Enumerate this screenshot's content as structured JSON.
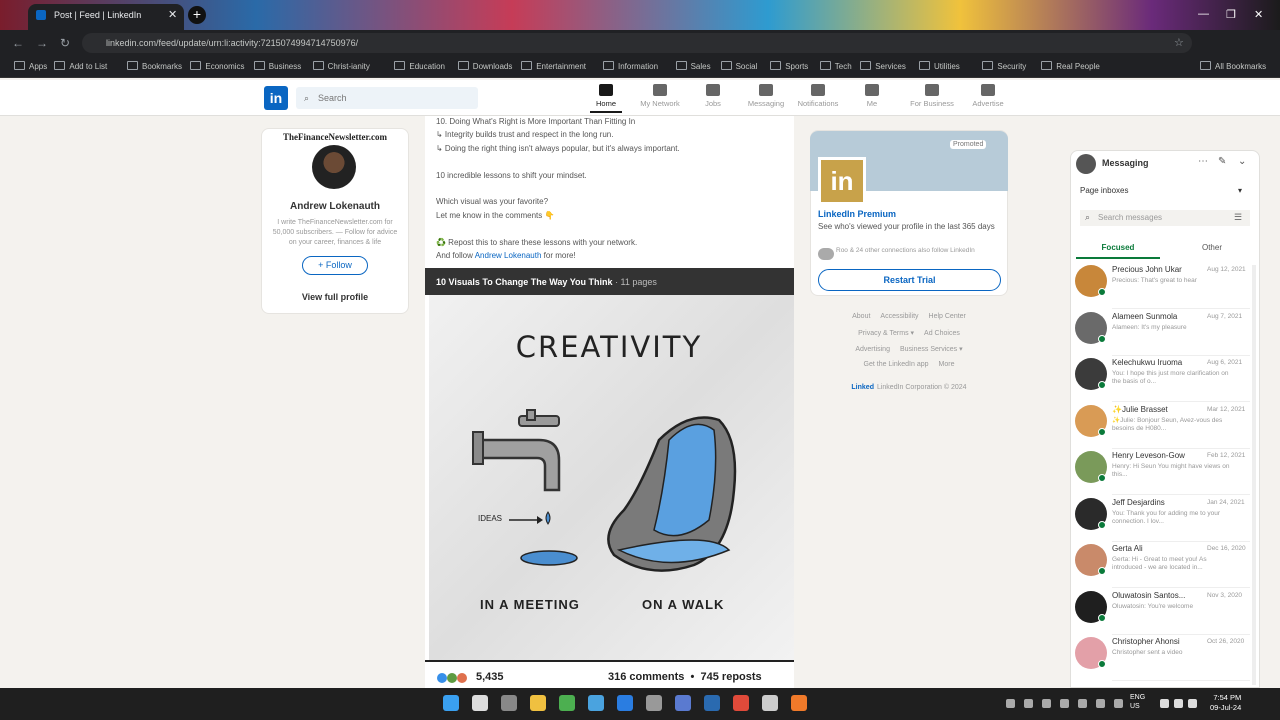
{
  "browser": {
    "tab_title": "Post | Feed | LinkedIn",
    "url": "linkedin.com/feed/update/urn:li:activity:7215074994714750976/",
    "bookmarks": [
      "Apps",
      "Add to List",
      "Bookmarks",
      "Economics",
      "Business",
      "Christ-ianity",
      "Education",
      "Downloads",
      "Entertainment",
      "Information",
      "Sales",
      "Social",
      "Sports",
      "Tech",
      "Services",
      "Utilities",
      "Security",
      "Real People"
    ],
    "all_bookmarks": "All Bookmarks"
  },
  "header": {
    "search_placeholder": "Search",
    "nav": [
      "Home",
      "My Network",
      "Jobs",
      "Messaging",
      "Notifications",
      "Me",
      "For Business",
      "Advertise"
    ]
  },
  "profile": {
    "newsletter": "TheFinanceNewsletter.com",
    "name": "Andrew Lokenauth",
    "desc": "I write TheFinanceNewsletter.com for 50,000 subscribers. — Follow for advice on your career, finances & life",
    "follow_label": "+ Follow",
    "view_profile": "View full profile"
  },
  "post": {
    "lines": [
      "10. Doing What's Right is More Important Than Fitting In",
      "↳ Integrity builds trust and respect in the long run.",
      "↳ Doing the right thing isn't always popular, but it's always important.",
      "10 incredible lessons to shift your mindset.",
      "Which visual was your favorite?",
      "Let me know in the comments 👇",
      "♻️ Repost this to share these lessons with your network.",
      "And follow"
    ],
    "author_link": "Andrew Lokenauth",
    "follow_suffix": "for more!",
    "doc_title": "10 Visuals To Change The Way You Think",
    "doc_pages": "· 11 pages",
    "slide_heading": "CREATIVITY",
    "ideas_label": "IDEAS",
    "caption_left": "IN A MEETING",
    "caption_right": "ON A WALK",
    "reactions": "5,435",
    "comments": "316 comments",
    "reposts": "745 reposts"
  },
  "promo": {
    "promoted": "Promoted",
    "title": "LinkedIn Premium",
    "body": "See who's viewed your profile in the last 365 days",
    "connections": "Roo & 24 other connections also follow LinkedIn",
    "cta": "Restart Trial"
  },
  "footer": {
    "links1": [
      "About",
      "Accessibility",
      "Help Center"
    ],
    "links2": [
      "Privacy & Terms ▾",
      "Ad Choices"
    ],
    "links3": [
      "Advertising",
      "Business Services ▾"
    ],
    "links4": [
      "Get the LinkedIn app",
      "More"
    ],
    "copyright": "LinkedIn Corporation © 2024"
  },
  "messaging": {
    "title": "Messaging",
    "inbox": "Page inboxes",
    "search_placeholder": "Search messages",
    "tab_focused": "Focused",
    "tab_other": "Other",
    "conversations": [
      {
        "name": "Precious John Ukar",
        "date": "Aug 12, 2021",
        "preview": "Precious: That's great to hear",
        "color": "#c8873a"
      },
      {
        "name": "Alameen Sunmola",
        "date": "Aug 7, 2021",
        "preview": "Alameen: It's my pleasure",
        "color": "#6a6a6a"
      },
      {
        "name": "Kelechukwu Iruoma",
        "date": "Aug 6, 2021",
        "preview": "You: I hope this just more clarification on the basis of o...",
        "color": "#3b3b3b"
      },
      {
        "name": "✨Julie Brasset",
        "date": "Mar 12, 2021",
        "preview": "✨Julie: Bonjour Seun, Avez-vous des besoins de H080...",
        "color": "#d99b55"
      },
      {
        "name": "Henry Leveson-Gow",
        "date": "Feb 12, 2021",
        "preview": "Henry: Hi Seun You might have views on this...",
        "color": "#7a9a5a"
      },
      {
        "name": "Jeff Desjardins",
        "date": "Jan 24, 2021",
        "preview": "You: Thank you for adding me to your connection. I lov...",
        "color": "#2a2a2a"
      },
      {
        "name": "Gerta Ali",
        "date": "Dec 16, 2020",
        "preview": "Gerta: Hi - Great to meet you! As introduced - we are located in...",
        "color": "#c98a6a"
      },
      {
        "name": "Oluwatosin Santos...",
        "date": "Nov 3, 2020",
        "preview": "Oluwatosin: You're welcome",
        "color": "#1f1f1f"
      },
      {
        "name": "Christopher Ahonsi",
        "date": "Oct 26, 2020",
        "preview": "Christopher sent a video",
        "color": "#e3a0a8"
      }
    ]
  },
  "taskbar": {
    "lang": "ENG",
    "region": "US",
    "time": "7:54 PM",
    "date": "09-Jul-24"
  }
}
